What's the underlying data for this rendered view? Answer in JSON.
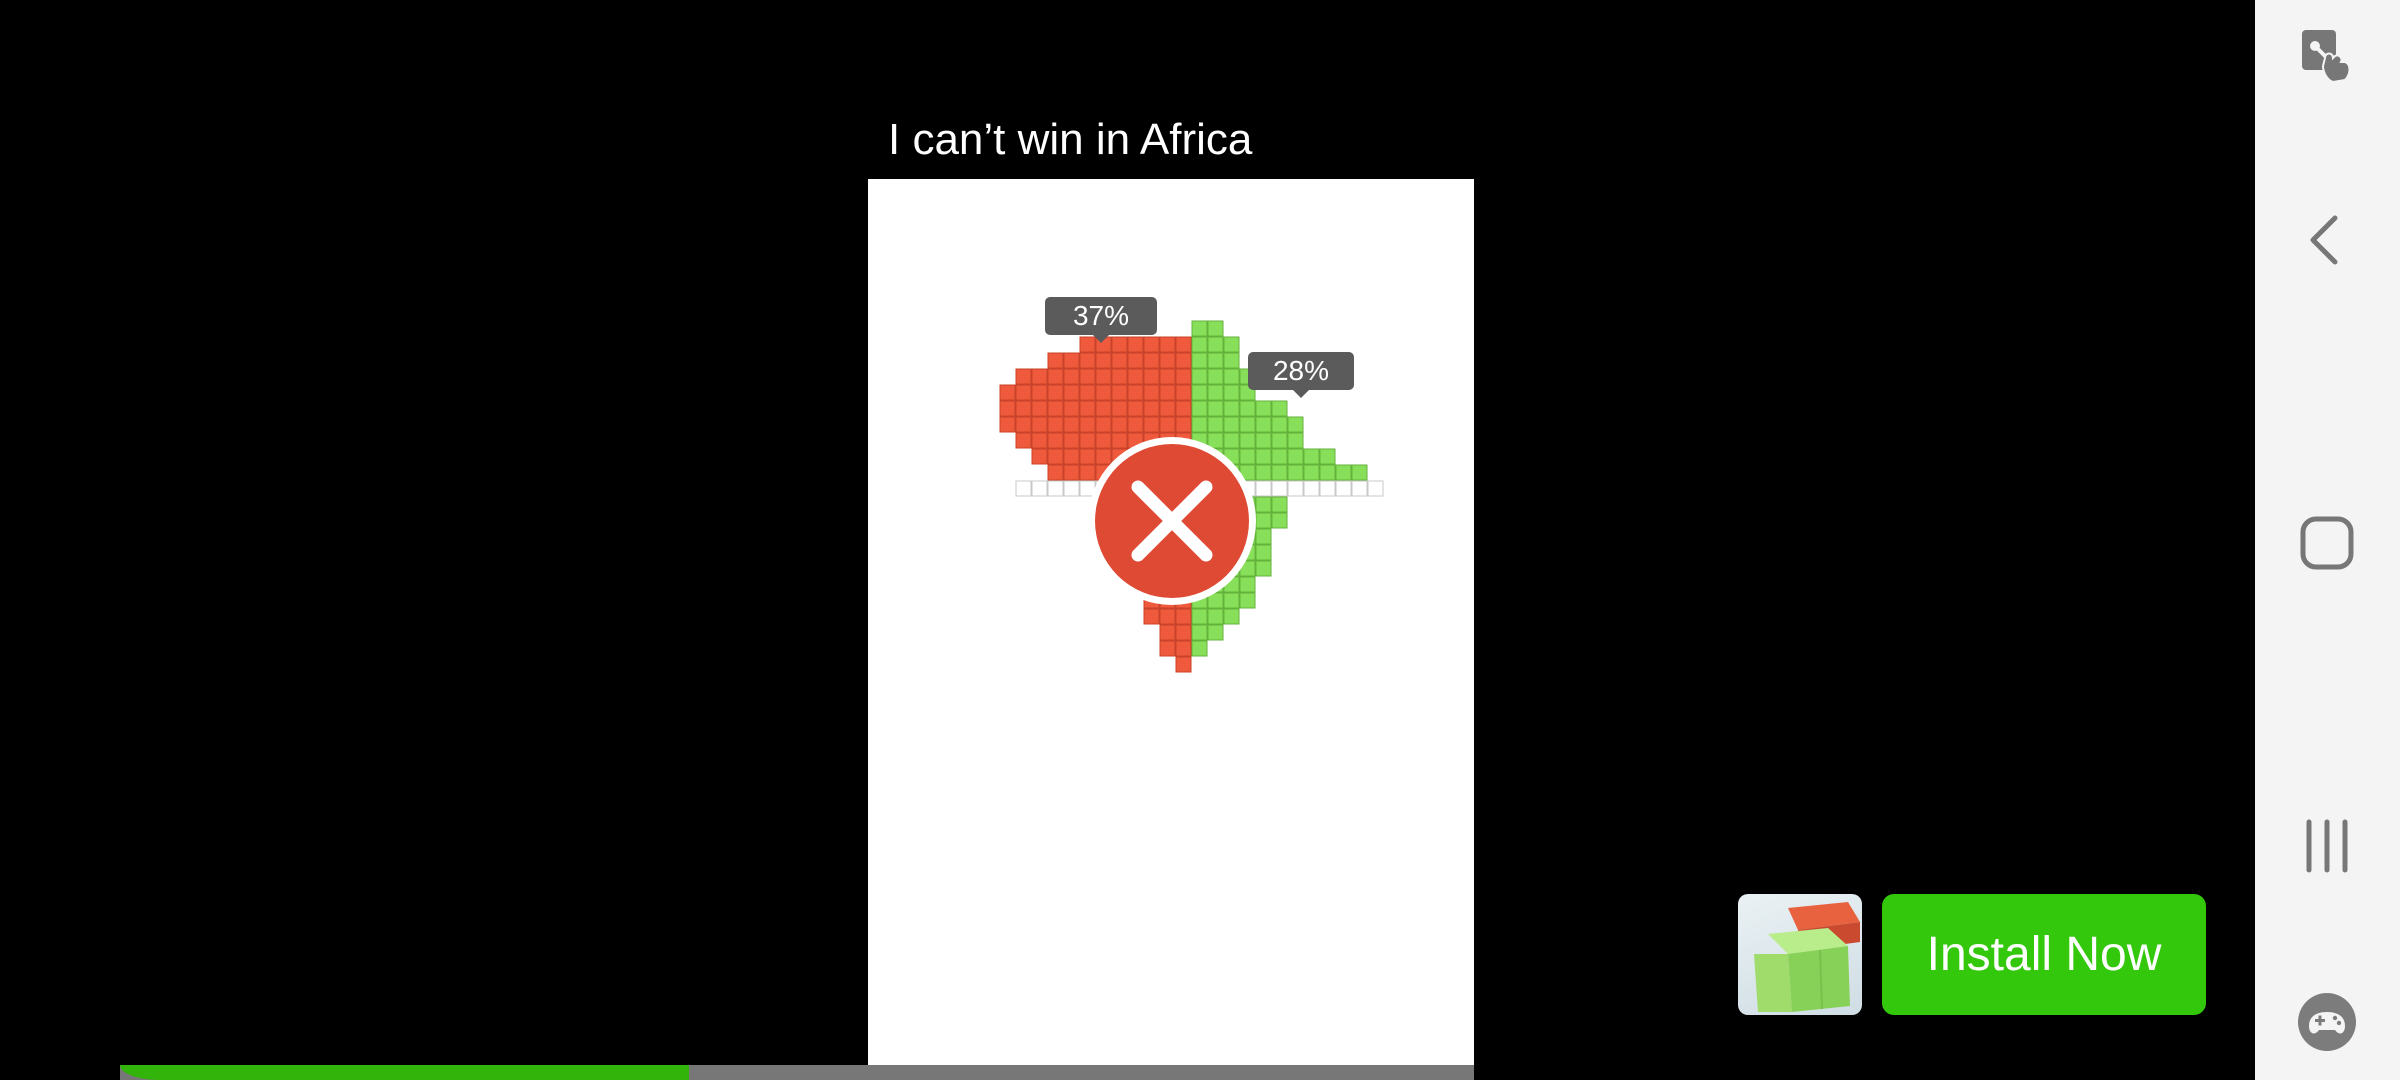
{
  "video": {
    "caption": "I can’t win in Africa",
    "red_percent_label": "37%",
    "green_percent_label": "28%",
    "result_icon": "fail-x-icon",
    "progress_fraction": 0.42
  },
  "ad": {
    "app_icon": "app-icon",
    "install_label": "Install Now"
  },
  "navbar": {
    "items": [
      "accessibility-icon",
      "back-icon",
      "home-icon",
      "recents-icon",
      "game-tools-icon"
    ]
  },
  "colors": {
    "red_team": "#ef5a3c",
    "green_team": "#88e05a",
    "install_button": "#33c80c",
    "progress_fill": "#33b40b",
    "fail_icon": "#df4a35"
  }
}
